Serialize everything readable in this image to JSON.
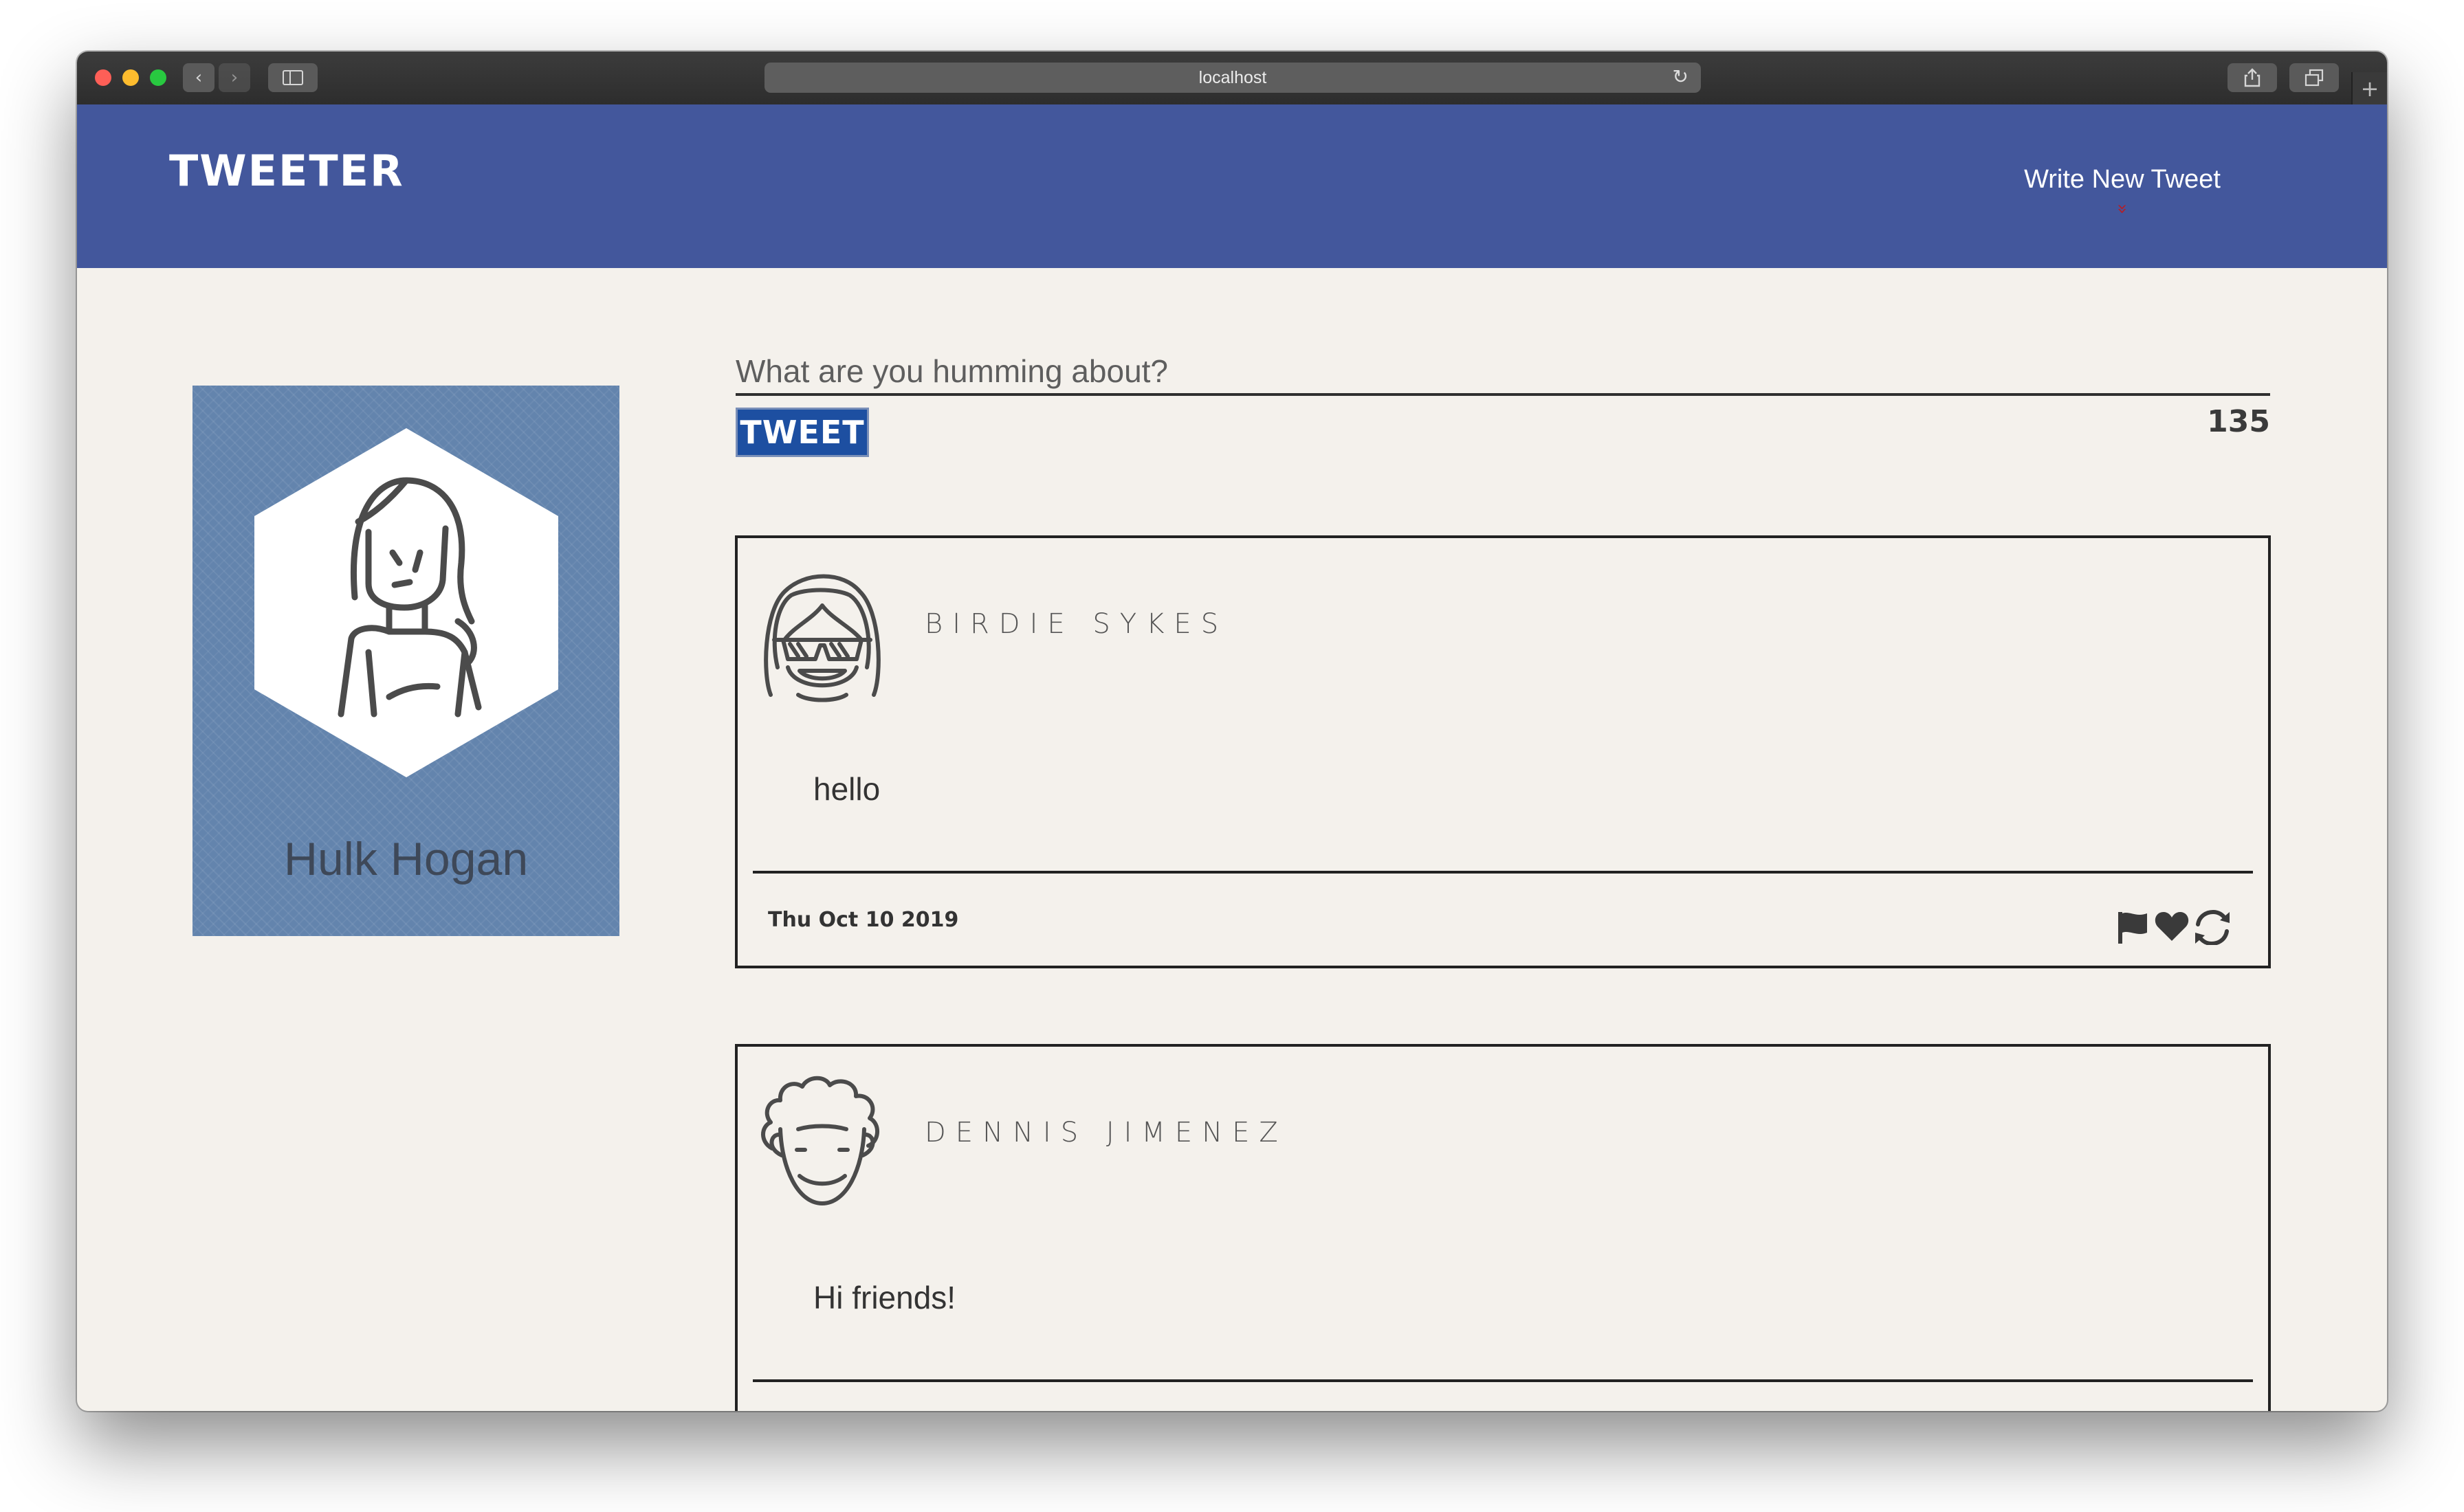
{
  "browser": {
    "url": "localhost",
    "back_icon": "‹",
    "forward_icon": "›",
    "reload_icon": "↻",
    "new_tab_icon": "+"
  },
  "header": {
    "logo": "TWEETER",
    "compose_toggle": "Write New Tweet",
    "compose_toggle_icon": "»"
  },
  "profile": {
    "name": "Hulk Hogan"
  },
  "compose": {
    "placeholder": "What are you humming about?",
    "submit_label": "TWEET",
    "char_counter": "135"
  },
  "tweets": [
    {
      "handle": "BIRDIE SYKES",
      "text": "hello",
      "date": "Thu Oct 10 2019"
    },
    {
      "handle": "DENNIS JIMENEZ",
      "text": "Hi friends!"
    }
  ],
  "colors": {
    "header_bg": "#43579c",
    "page_bg": "#f4f1ec",
    "profile_bg": "#6384ad",
    "tweet_button_bg": "#1d4fa1",
    "chevron": "#b0202c"
  }
}
